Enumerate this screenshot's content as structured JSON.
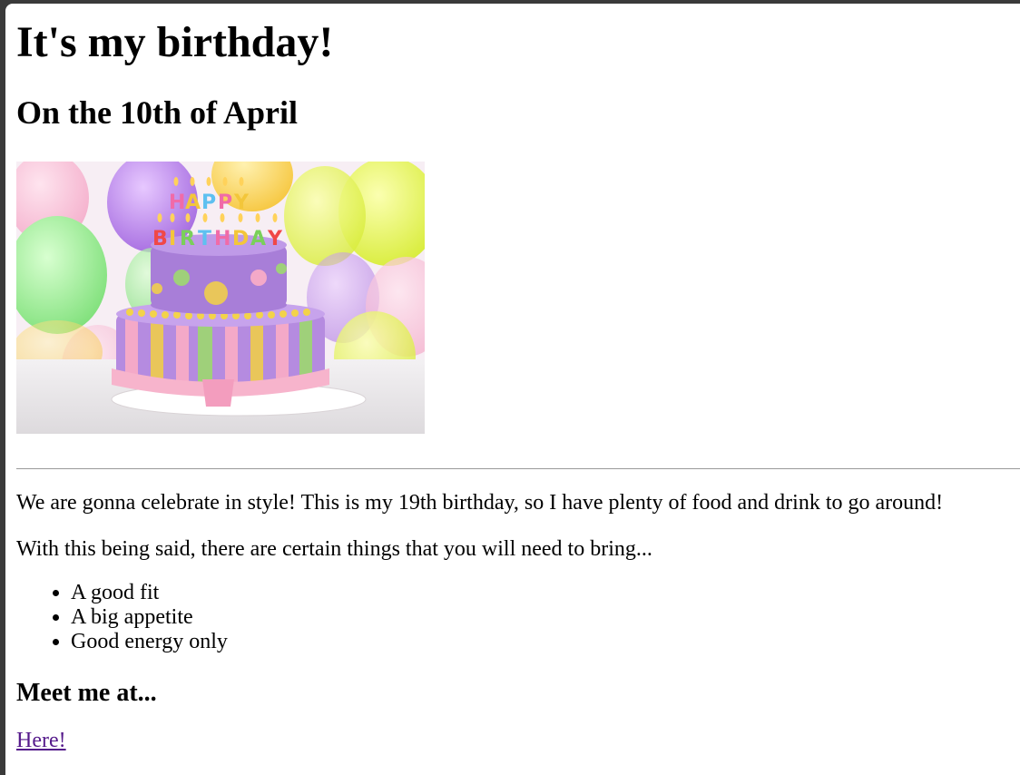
{
  "page": {
    "heading": "It's my birthday!",
    "subheading": "On the 10th of April",
    "image": {
      "name": "birthday-cake-image",
      "cake_letters": "HAPPY BIRTHDAY"
    },
    "paragraphs": [
      "We are gonna celebrate in style! This is my 19th birthday, so I have plenty of food and drink to go around!",
      "With this being said, there are certain things that you will need to bring..."
    ],
    "bring_list": [
      "A good fit",
      "A big appetite",
      "Good energy only"
    ],
    "meet_heading": "Meet me at...",
    "link_text": "Here!"
  },
  "colors": {
    "link_visited": "#551a8b",
    "frame": "#3a3a3a",
    "rule": "#9a9a9a"
  }
}
